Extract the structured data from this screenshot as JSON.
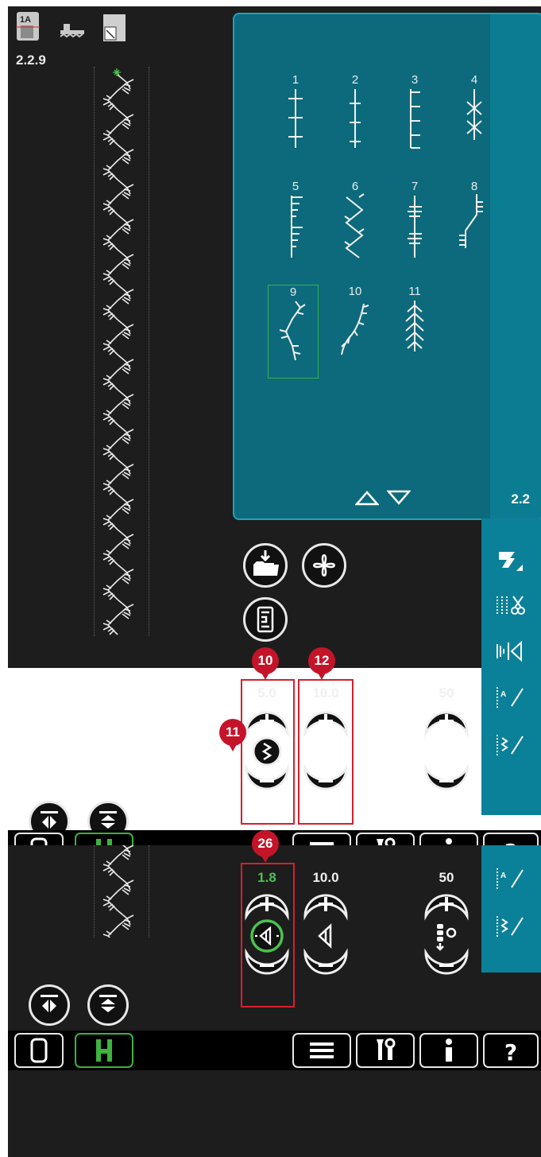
{
  "screen1": {
    "stitch_code": "2.2.9",
    "menu": {
      "stitches": [
        {
          "num": "1"
        },
        {
          "num": "2"
        },
        {
          "num": "3"
        },
        {
          "num": "4"
        },
        {
          "num": "5"
        },
        {
          "num": "6"
        },
        {
          "num": "7"
        },
        {
          "num": "8"
        },
        {
          "num": "9",
          "selected": true
        },
        {
          "num": "10"
        },
        {
          "num": "11"
        }
      ],
      "page": "2.2"
    },
    "stitch_width": "5.0",
    "stitch_length": "10.0",
    "density": "50",
    "callouts": {
      "width": "10",
      "icon": "11",
      "length": "12"
    }
  },
  "screen2": {
    "stitch_width": "1.8",
    "stitch_length": "10.0",
    "density": "50",
    "callout": "26"
  },
  "toolbar": {
    "help_label": "?"
  },
  "colors": {
    "panel": "#0c6a7c",
    "accent_green": "#4cc24f",
    "callout_red": "#c4142a",
    "screen_bg": "#1d1d1d"
  }
}
